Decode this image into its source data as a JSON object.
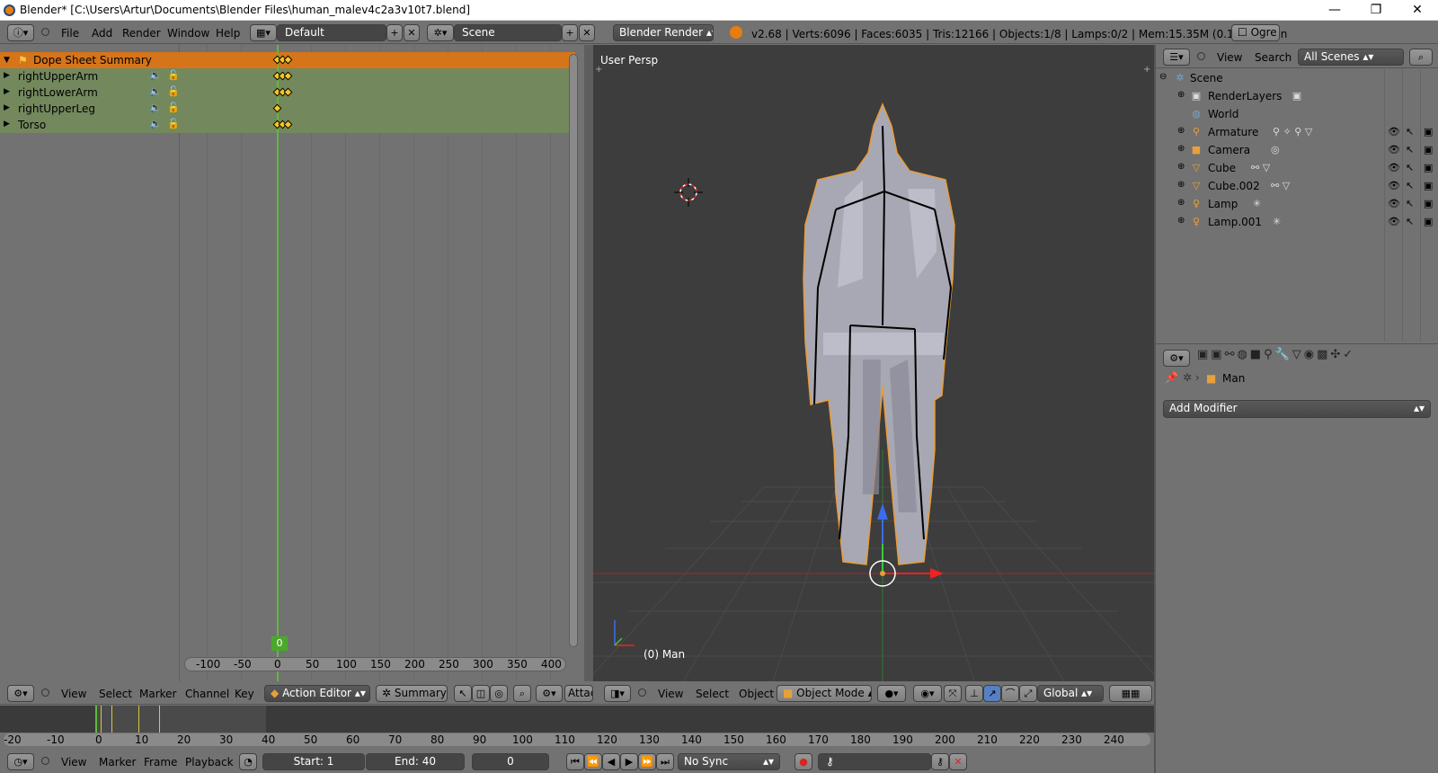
{
  "window": {
    "title": "Blender* [C:\\Users\\Artur\\Documents\\Blender Files\\human_malev4c2a3v10t7.blend]",
    "minimize": "—",
    "maximize": "❐",
    "close": "✕"
  },
  "info_header": {
    "menus": [
      "File",
      "Add",
      "Render",
      "Window",
      "Help"
    ],
    "layout": "Default",
    "scene": "Scene",
    "engine": "Blender Render",
    "stats": "v2.68 | Verts:6096 | Faces:6035 | Tris:12166 | Objects:1/8 | Lamps:0/2 | Mem:15.35M (0.11M) | Man",
    "ogre": "Ogre"
  },
  "dopesheet": {
    "channels": [
      {
        "label": "Dope Sheet Summary",
        "type": "summary"
      },
      {
        "label": "rightUpperArm",
        "type": "object"
      },
      {
        "label": "rightLowerArm",
        "type": "object"
      },
      {
        "label": "rightUpperLeg",
        "type": "object"
      },
      {
        "label": "Torso",
        "type": "object"
      }
    ],
    "ticks": [
      "-100",
      "-50",
      "0",
      "50",
      "100",
      "150",
      "200",
      "250",
      "300",
      "350",
      "400"
    ],
    "current_frame": "0",
    "header_menus": [
      "View",
      "Select",
      "Marker",
      "Channel",
      "Key"
    ],
    "mode": "Action Editor",
    "summary_btn": "Summary",
    "attach": "Attac"
  },
  "viewport": {
    "label": "User Persp",
    "object_label": "(0) Man",
    "header_menus": [
      "View",
      "Select",
      "Object"
    ],
    "mode": "Object Mode",
    "orientation": "Global"
  },
  "outliner": {
    "header_menus": [
      "View",
      "Search"
    ],
    "filter": "All Scenes",
    "items": [
      {
        "label": "Scene",
        "icon": "scene-icon",
        "color": "#7aa3c4"
      },
      {
        "label": "RenderLayers",
        "icon": "render-layers-icon",
        "color": "#c8c8c8"
      },
      {
        "label": "World",
        "icon": "world-icon",
        "color": "#7aa3c4"
      },
      {
        "label": "Armature",
        "icon": "armature-icon",
        "color": "#e8a03c"
      },
      {
        "label": "Camera",
        "icon": "camera-icon",
        "color": "#e8a03c"
      },
      {
        "label": "Cube",
        "icon": "mesh-icon",
        "color": "#e8a03c"
      },
      {
        "label": "Cube.002",
        "icon": "mesh-icon",
        "color": "#e8a03c"
      },
      {
        "label": "Lamp",
        "icon": "lamp-icon",
        "color": "#e8a03c"
      },
      {
        "label": "Lamp.001",
        "icon": "lamp-icon",
        "color": "#e8a03c"
      }
    ]
  },
  "properties": {
    "context_object": "Man",
    "add_modifier": "Add Modifier"
  },
  "timeline": {
    "ticks": [
      "-20",
      "-10",
      "0",
      "10",
      "20",
      "30",
      "40",
      "50",
      "60",
      "70",
      "80",
      "90",
      "100",
      "110",
      "120",
      "130",
      "140",
      "150",
      "160",
      "170",
      "180",
      "190",
      "200",
      "210",
      "220",
      "230",
      "240"
    ],
    "header_menus": [
      "View",
      "Marker",
      "Frame",
      "Playback"
    ],
    "start": "Start: 1",
    "end": "End: 40",
    "frame": "0",
    "sync": "No Sync"
  },
  "colors": {
    "summary_row": "#d6741a",
    "object_row": "#73885d",
    "keyframe": "#f5c825",
    "current_frame": "#5eba3c",
    "viewport_bg": "#3d3d3d"
  }
}
